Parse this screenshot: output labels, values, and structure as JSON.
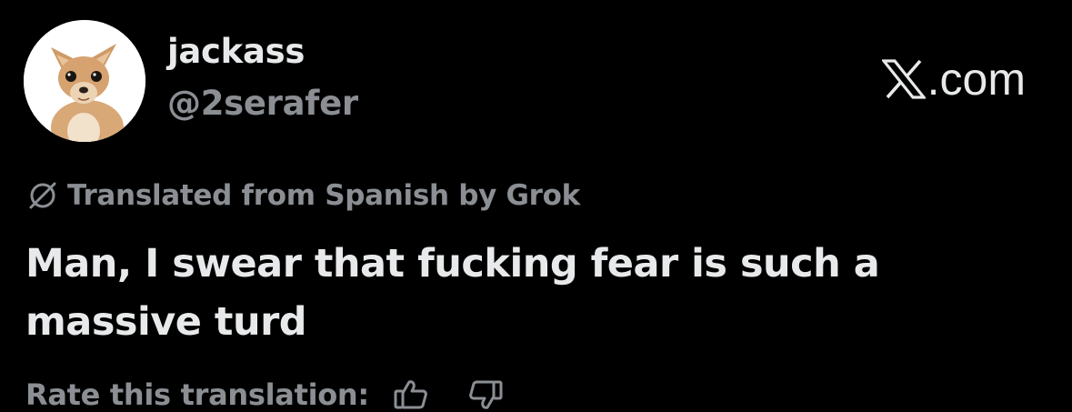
{
  "user": {
    "display_name": "jackass",
    "handle": "@2serafer",
    "avatar_icon": "chihuahua-avatar"
  },
  "brand": {
    "logo_icon": "x-logo-icon",
    "text": ".com"
  },
  "translation": {
    "notice": "Translated from Spanish by Grok",
    "icon": "grok-slash-icon"
  },
  "post": {
    "text": "Man, I swear that fucking fear is such a massive turd"
  },
  "rating": {
    "label": "Rate this translation:",
    "up_icon": "thumbs-up-icon",
    "down_icon": "thumbs-down-icon"
  },
  "colors": {
    "background": "#000000",
    "primary_text": "#e7e9ea",
    "secondary_text": "#8b8f94"
  }
}
